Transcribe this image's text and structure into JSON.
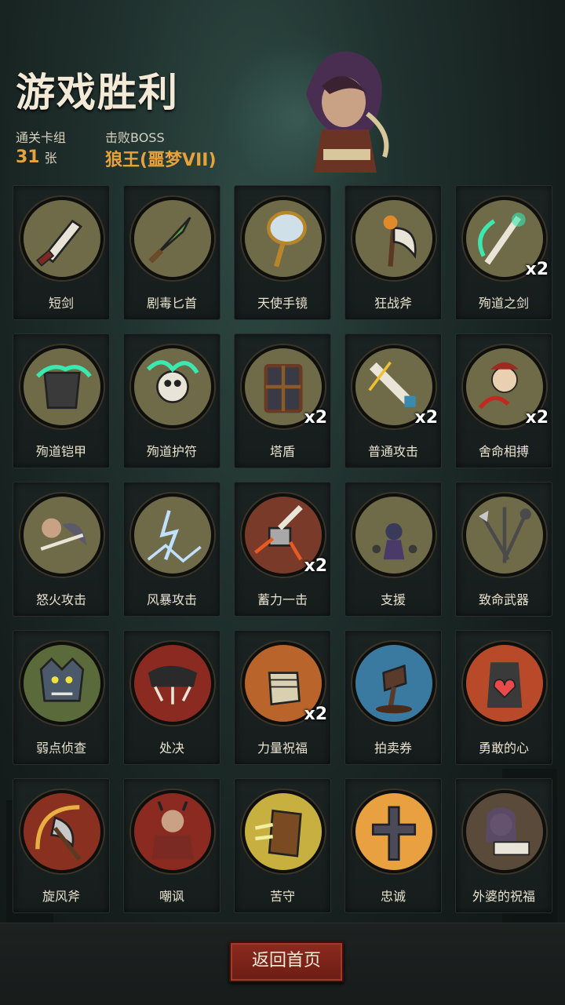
{
  "header": {
    "title": "游戏胜利",
    "deck_label": "通关卡组",
    "deck_count": "31",
    "deck_unit": "张",
    "boss_label": "击败BOSS",
    "boss_name": "狼王(噩梦VII)"
  },
  "cards": [
    {
      "label": "短剑",
      "icon": "short-sword-icon",
      "bg": "#6f6a48",
      "count": ""
    },
    {
      "label": "剧毒匕首",
      "icon": "poison-dagger-icon",
      "bg": "#6f6a48",
      "count": ""
    },
    {
      "label": "天使手镜",
      "icon": "angel-hand-mirror-icon",
      "bg": "#6f6a48",
      "count": ""
    },
    {
      "label": "狂战斧",
      "icon": "berserker-axe-icon",
      "bg": "#6f6a48",
      "count": ""
    },
    {
      "label": "殉道之剑",
      "icon": "martyr-sword-icon",
      "bg": "#6f6a48",
      "count": "x2"
    },
    {
      "label": "殉道铠甲",
      "icon": "martyr-armor-icon",
      "bg": "#6f6a48",
      "count": ""
    },
    {
      "label": "殉道护符",
      "icon": "martyr-amulet-icon",
      "bg": "#6f6a48",
      "count": ""
    },
    {
      "label": "塔盾",
      "icon": "tower-shield-icon",
      "bg": "#6f6a48",
      "count": "x2"
    },
    {
      "label": "普通攻击",
      "icon": "normal-attack-icon",
      "bg": "#6f6a48",
      "count": "x2"
    },
    {
      "label": "舍命相搏",
      "icon": "desperate-fight-icon",
      "bg": "#6f6a48",
      "count": "x2"
    },
    {
      "label": "怒火攻击",
      "icon": "fury-attack-icon",
      "bg": "#6f6a48",
      "count": ""
    },
    {
      "label": "风暴攻击",
      "icon": "storm-attack-icon",
      "bg": "#6f6a48",
      "count": ""
    },
    {
      "label": "蓄力一击",
      "icon": "charged-strike-icon",
      "bg": "#7a3a2a",
      "count": "x2"
    },
    {
      "label": "支援",
      "icon": "support-icon",
      "bg": "#6f6a48",
      "count": ""
    },
    {
      "label": "致命武器",
      "icon": "deadly-weapons-icon",
      "bg": "#6f6a48",
      "count": ""
    },
    {
      "label": "弱点侦查",
      "icon": "weakness-scout-icon",
      "bg": "#5a6a3a",
      "count": ""
    },
    {
      "label": "处决",
      "icon": "execution-icon",
      "bg": "#8a2a20",
      "count": ""
    },
    {
      "label": "力量祝福",
      "icon": "strength-blessing-icon",
      "bg": "#b8642a",
      "count": "x2"
    },
    {
      "label": "拍卖券",
      "icon": "auction-ticket-icon",
      "bg": "#3a7aa0",
      "count": ""
    },
    {
      "label": "勇敢的心",
      "icon": "brave-heart-icon",
      "bg": "#b84a2a",
      "count": ""
    },
    {
      "label": "旋风斧",
      "icon": "whirlwind-axe-icon",
      "bg": "#8a3020",
      "count": ""
    },
    {
      "label": "嘲讽",
      "icon": "taunt-icon",
      "bg": "#8a2a20",
      "count": ""
    },
    {
      "label": "苦守",
      "icon": "hard-defense-icon",
      "bg": "#c8b040",
      "count": ""
    },
    {
      "label": "忠诚",
      "icon": "loyalty-icon",
      "bg": "#e8a040",
      "count": ""
    },
    {
      "label": "外婆的祝福",
      "icon": "grandma-blessing-icon",
      "bg": "#5a4a3a",
      "count": ""
    }
  ],
  "footer": {
    "return_label": "返回首页"
  }
}
